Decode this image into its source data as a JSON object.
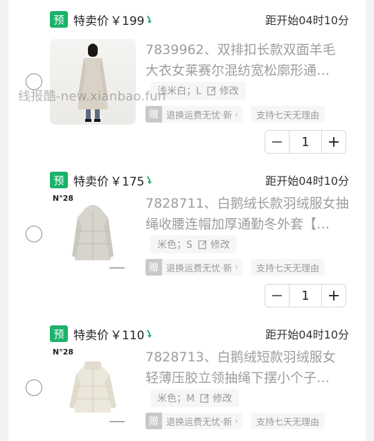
{
  "watermark": "线报酷-new.xianbao.fun",
  "colors": {
    "accent": "#1ab36a",
    "title_gray": "#9d9d9d"
  },
  "items": [
    {
      "badge": "预",
      "price_label": "特卖价",
      "price": "￥199",
      "price_trend_icon": "down-arrow-icon",
      "countdown": "距开始04时10分",
      "title_line1": "7839962、双排扣长款双面羊毛",
      "title_line2": "大衣女莱赛尔混纺宽松廓形通…",
      "spec": "浅米白；L",
      "spec_edit": "修改",
      "gift_badge": "赠",
      "gift_text": "退换运费无忧·新",
      "return_text": "支持七天无理由",
      "quantity": "1",
      "minus": "−",
      "plus": "+"
    },
    {
      "badge": "预",
      "price_label": "特卖价",
      "price": "￥175",
      "price_trend_icon": "down-arrow-icon",
      "countdown": "距开始04时10分",
      "brand_mark": "N°28",
      "title_line1": "7828711、白鹅绒长款羽绒服女抽",
      "title_line2": "绳收腰连帽加厚通勤冬外套【…",
      "spec": "米色；S",
      "spec_edit": "修改",
      "gift_badge": "赠",
      "gift_text": "退换运费无忧·新",
      "return_text": "支持七天无理由",
      "quantity": "1",
      "minus": "−",
      "plus": "+"
    },
    {
      "badge": "预",
      "price_label": "特卖价",
      "price": "￥110",
      "price_trend_icon": "down-arrow-icon",
      "countdown": "距开始04时10分",
      "brand_mark": "N°28",
      "title_line1": "7828713、白鹅绒短款羽绒服女",
      "title_line2": "轻薄压胶立领抽绳下摆小个子…",
      "spec": "米色；M",
      "spec_edit": "修改",
      "gift_badge": "赠",
      "gift_text": "退换运费无忧·新",
      "return_text": "支持七天无理由"
    }
  ]
}
